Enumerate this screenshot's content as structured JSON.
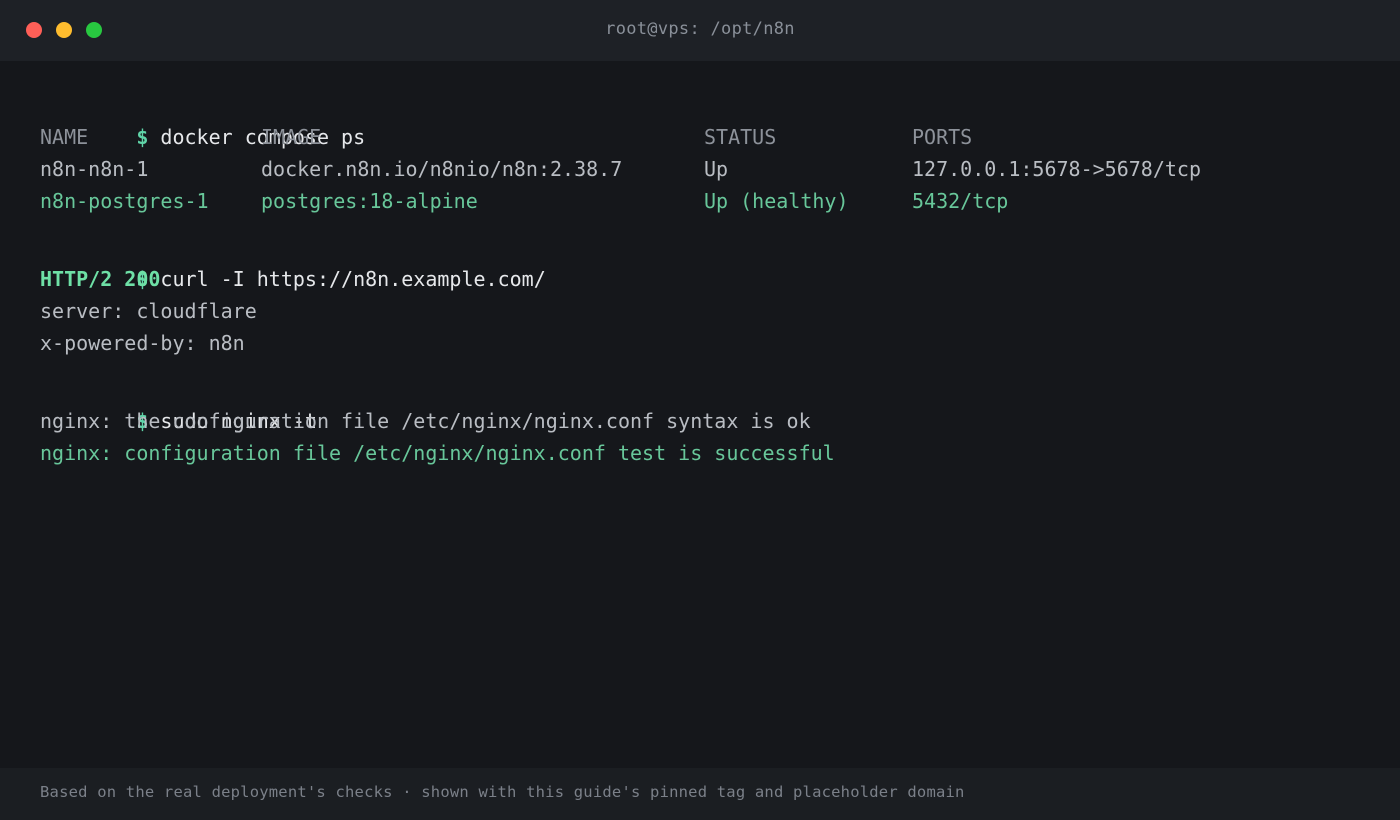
{
  "window": {
    "title": "root@vps: /opt/n8n",
    "colors": {
      "close": "#ff5f57",
      "minimize": "#febc2e",
      "maximize": "#28c840"
    }
  },
  "terminal": {
    "prompt_symbol": "$",
    "docker": {
      "command": "docker compose ps",
      "headers": [
        "NAME",
        "IMAGE",
        "STATUS",
        "PORTS"
      ],
      "rows": [
        [
          "n8n-n8n-1",
          "docker.n8n.io/n8nio/n8n:2.38.7",
          "Up",
          "127.0.0.1:5678->5678/tcp"
        ],
        [
          "n8n-postgres-1",
          "postgres:18-alpine",
          "Up (healthy)",
          "5432/tcp"
        ]
      ]
    },
    "curl": {
      "command": "curl -I https://n8n.example.com/",
      "status": "HTTP/2 200",
      "headers": [
        "server: cloudflare",
        "x-powered-by: n8n"
      ]
    },
    "nginx": {
      "command": "sudo nginx -t",
      "output": [
        "nginx: the configuration file /etc/nginx/nginx.conf syntax is ok",
        "nginx: configuration file /etc/nginx/nginx.conf test is successful"
      ]
    }
  },
  "footer": {
    "caption": "Based on the real deployment's checks · shown with this guide's pinned tag and placeholder domain"
  }
}
